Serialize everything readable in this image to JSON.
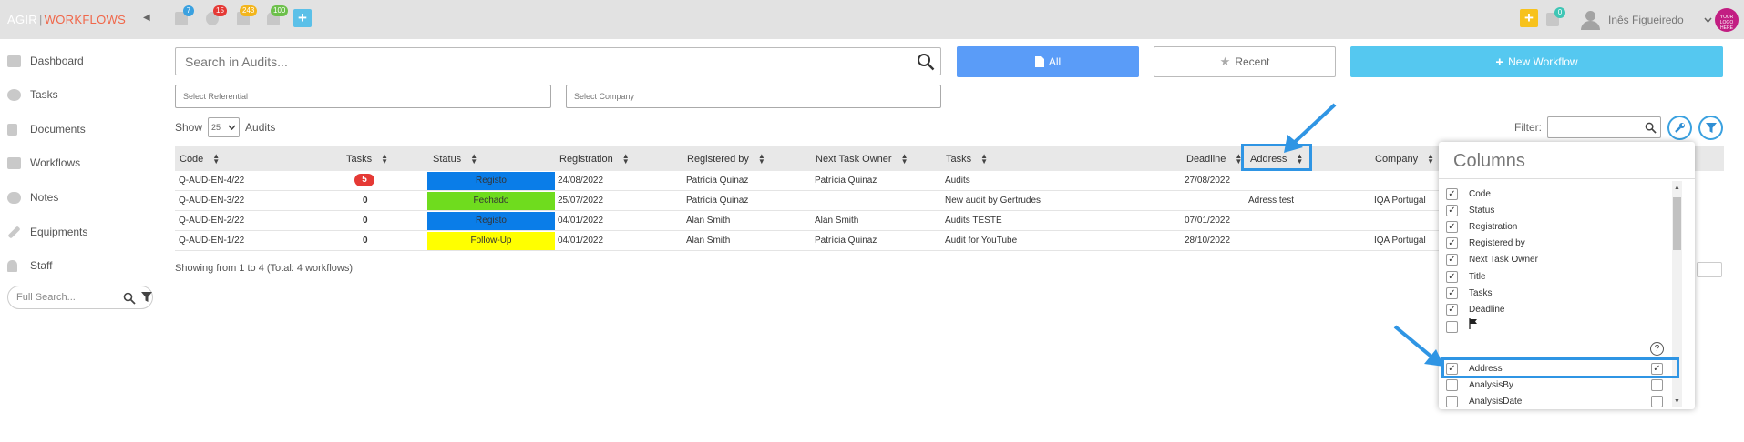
{
  "header": {
    "brand_part1": "AGIR",
    "brand_sep": "|",
    "brand_part2": "WORKFLOWS",
    "badges": [
      {
        "icon": "calendar-icon",
        "count": "7",
        "color": "#3aa1e0"
      },
      {
        "icon": "gear-icon",
        "count": "15",
        "color": "#e53935"
      },
      {
        "icon": "clipboard-icon",
        "count": "243",
        "color": "#f3b51b"
      },
      {
        "icon": "bell-icon",
        "count": "100",
        "color": "#6cc04a"
      }
    ],
    "right_badge_count": "0",
    "user_name": "Inês Figueiredo",
    "logo_text": "YOUR LOGO HERE",
    "colors": {
      "add_blue": "#5bc0e8",
      "add_yellow": "#f7c21c",
      "topbar": "#e2e2e2"
    }
  },
  "sidebar": {
    "items": [
      {
        "label": "Dashboard",
        "icon": "home-icon"
      },
      {
        "label": "Tasks",
        "icon": "gear-icon"
      },
      {
        "label": "Documents",
        "icon": "document-icon"
      },
      {
        "label": "Workflows",
        "icon": "workflow-icon"
      },
      {
        "label": "Notes",
        "icon": "chat-icon"
      },
      {
        "label": "Equipments",
        "icon": "wrench-icon"
      },
      {
        "label": "Staff",
        "icon": "user-icon"
      }
    ],
    "full_search_placeholder": "Full Search..."
  },
  "toolbar": {
    "search_placeholder": "Search in Audits...",
    "all_label": "All",
    "recent_label": "Recent",
    "new_workflow_label": "New Workflow",
    "referential_placeholder": "Select Referential",
    "company_placeholder": "Select Company",
    "show_label": "Show",
    "per_page": "25",
    "audits_label": "Audits",
    "filter_label": "Filter:"
  },
  "table": {
    "headers": [
      "Code",
      "Tasks",
      "Status",
      "Registration",
      "Registered by",
      "Next Task Owner",
      "Tasks",
      "Deadline",
      "Address",
      "Company"
    ],
    "rows": [
      {
        "code": "Q-AUD-EN-4/22",
        "tasks": "5",
        "status": "Registo",
        "status_color": "#0a7de8",
        "registration": "24/08/2022",
        "registered_by": "Patrícia Quinaz",
        "next_owner": "Patrícia Quinaz",
        "title": "Audits",
        "deadline": "27/08/2022",
        "address": "",
        "company": ""
      },
      {
        "code": "Q-AUD-EN-3/22",
        "tasks": "0",
        "status": "Fechado",
        "status_color": "#6fdc1e",
        "registration": "25/07/2022",
        "registered_by": "Patrícia Quinaz",
        "next_owner": "",
        "title": "New audit by Gertrudes",
        "deadline": "",
        "address": "Adress test",
        "company": "IQA Portugal"
      },
      {
        "code": "Q-AUD-EN-2/22",
        "tasks": "0",
        "status": "Registo",
        "status_color": "#0a7de8",
        "registration": "04/01/2022",
        "registered_by": "Alan Smith",
        "next_owner": "Alan Smith",
        "title": "Audits TESTE",
        "deadline": "07/01/2022",
        "address": "",
        "company": ""
      },
      {
        "code": "Q-AUD-EN-1/22",
        "tasks": "0",
        "status": "Follow-Up",
        "status_color": "#ffff00",
        "registration": "04/01/2022",
        "registered_by": "Alan Smith",
        "next_owner": "Patrícia Quinaz",
        "title": "Audit for YouTube",
        "deadline": "28/10/2022",
        "address": "",
        "company": "IQA Portugal"
      }
    ],
    "showing_text": "Showing from 1 to 4 (Total: 4 workflows)"
  },
  "columns_popup": {
    "title": "Columns",
    "items": [
      {
        "label": "Code",
        "checked": true
      },
      {
        "label": "Status",
        "checked": true
      },
      {
        "label": "Registration",
        "checked": true
      },
      {
        "label": "Registered by",
        "checked": true
      },
      {
        "label": "Next Task Owner",
        "checked": true
      },
      {
        "label": "Title",
        "checked": true
      },
      {
        "label": "Tasks",
        "checked": true
      },
      {
        "label": "Deadline",
        "checked": true
      },
      {
        "label": "",
        "icon": "flag-icon",
        "checked": false
      }
    ],
    "extra_items": [
      {
        "label": "Address",
        "checked": true,
        "right_checked": true
      },
      {
        "label": "AnalysisBy",
        "checked": false,
        "right_checked": false
      },
      {
        "label": "AnalysisDate",
        "checked": false,
        "right_checked": false
      }
    ]
  }
}
